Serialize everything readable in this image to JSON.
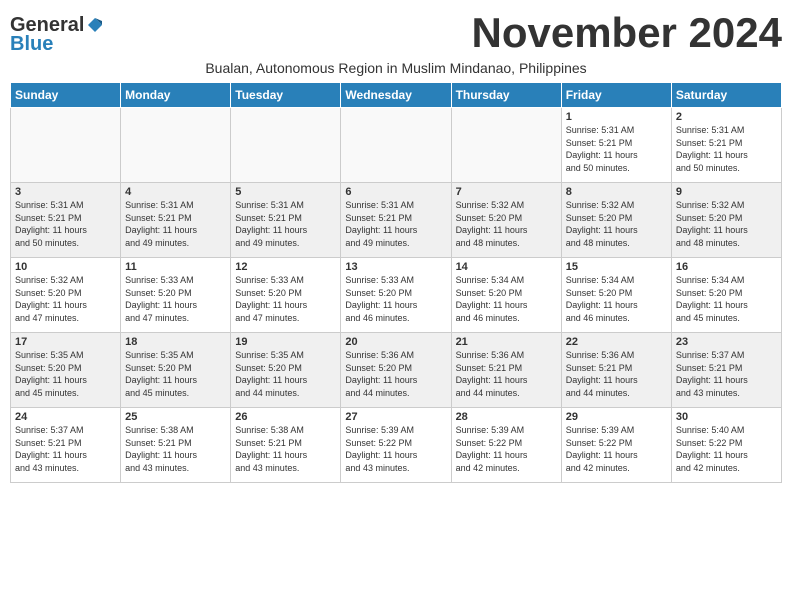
{
  "logo": {
    "general": "General",
    "blue": "Blue"
  },
  "title": "November 2024",
  "subtitle": "Bualan, Autonomous Region in Muslim Mindanao, Philippines",
  "days_of_week": [
    "Sunday",
    "Monday",
    "Tuesday",
    "Wednesday",
    "Thursday",
    "Friday",
    "Saturday"
  ],
  "weeks": [
    [
      {
        "day": "",
        "info": ""
      },
      {
        "day": "",
        "info": ""
      },
      {
        "day": "",
        "info": ""
      },
      {
        "day": "",
        "info": ""
      },
      {
        "day": "",
        "info": ""
      },
      {
        "day": "1",
        "info": "Sunrise: 5:31 AM\nSunset: 5:21 PM\nDaylight: 11 hours\nand 50 minutes."
      },
      {
        "day": "2",
        "info": "Sunrise: 5:31 AM\nSunset: 5:21 PM\nDaylight: 11 hours\nand 50 minutes."
      }
    ],
    [
      {
        "day": "3",
        "info": "Sunrise: 5:31 AM\nSunset: 5:21 PM\nDaylight: 11 hours\nand 50 minutes."
      },
      {
        "day": "4",
        "info": "Sunrise: 5:31 AM\nSunset: 5:21 PM\nDaylight: 11 hours\nand 49 minutes."
      },
      {
        "day": "5",
        "info": "Sunrise: 5:31 AM\nSunset: 5:21 PM\nDaylight: 11 hours\nand 49 minutes."
      },
      {
        "day": "6",
        "info": "Sunrise: 5:31 AM\nSunset: 5:21 PM\nDaylight: 11 hours\nand 49 minutes."
      },
      {
        "day": "7",
        "info": "Sunrise: 5:32 AM\nSunset: 5:20 PM\nDaylight: 11 hours\nand 48 minutes."
      },
      {
        "day": "8",
        "info": "Sunrise: 5:32 AM\nSunset: 5:20 PM\nDaylight: 11 hours\nand 48 minutes."
      },
      {
        "day": "9",
        "info": "Sunrise: 5:32 AM\nSunset: 5:20 PM\nDaylight: 11 hours\nand 48 minutes."
      }
    ],
    [
      {
        "day": "10",
        "info": "Sunrise: 5:32 AM\nSunset: 5:20 PM\nDaylight: 11 hours\nand 47 minutes."
      },
      {
        "day": "11",
        "info": "Sunrise: 5:33 AM\nSunset: 5:20 PM\nDaylight: 11 hours\nand 47 minutes."
      },
      {
        "day": "12",
        "info": "Sunrise: 5:33 AM\nSunset: 5:20 PM\nDaylight: 11 hours\nand 47 minutes."
      },
      {
        "day": "13",
        "info": "Sunrise: 5:33 AM\nSunset: 5:20 PM\nDaylight: 11 hours\nand 46 minutes."
      },
      {
        "day": "14",
        "info": "Sunrise: 5:34 AM\nSunset: 5:20 PM\nDaylight: 11 hours\nand 46 minutes."
      },
      {
        "day": "15",
        "info": "Sunrise: 5:34 AM\nSunset: 5:20 PM\nDaylight: 11 hours\nand 46 minutes."
      },
      {
        "day": "16",
        "info": "Sunrise: 5:34 AM\nSunset: 5:20 PM\nDaylight: 11 hours\nand 45 minutes."
      }
    ],
    [
      {
        "day": "17",
        "info": "Sunrise: 5:35 AM\nSunset: 5:20 PM\nDaylight: 11 hours\nand 45 minutes."
      },
      {
        "day": "18",
        "info": "Sunrise: 5:35 AM\nSunset: 5:20 PM\nDaylight: 11 hours\nand 45 minutes."
      },
      {
        "day": "19",
        "info": "Sunrise: 5:35 AM\nSunset: 5:20 PM\nDaylight: 11 hours\nand 44 minutes."
      },
      {
        "day": "20",
        "info": "Sunrise: 5:36 AM\nSunset: 5:20 PM\nDaylight: 11 hours\nand 44 minutes."
      },
      {
        "day": "21",
        "info": "Sunrise: 5:36 AM\nSunset: 5:21 PM\nDaylight: 11 hours\nand 44 minutes."
      },
      {
        "day": "22",
        "info": "Sunrise: 5:36 AM\nSunset: 5:21 PM\nDaylight: 11 hours\nand 44 minutes."
      },
      {
        "day": "23",
        "info": "Sunrise: 5:37 AM\nSunset: 5:21 PM\nDaylight: 11 hours\nand 43 minutes."
      }
    ],
    [
      {
        "day": "24",
        "info": "Sunrise: 5:37 AM\nSunset: 5:21 PM\nDaylight: 11 hours\nand 43 minutes."
      },
      {
        "day": "25",
        "info": "Sunrise: 5:38 AM\nSunset: 5:21 PM\nDaylight: 11 hours\nand 43 minutes."
      },
      {
        "day": "26",
        "info": "Sunrise: 5:38 AM\nSunset: 5:21 PM\nDaylight: 11 hours\nand 43 minutes."
      },
      {
        "day": "27",
        "info": "Sunrise: 5:39 AM\nSunset: 5:22 PM\nDaylight: 11 hours\nand 43 minutes."
      },
      {
        "day": "28",
        "info": "Sunrise: 5:39 AM\nSunset: 5:22 PM\nDaylight: 11 hours\nand 42 minutes."
      },
      {
        "day": "29",
        "info": "Sunrise: 5:39 AM\nSunset: 5:22 PM\nDaylight: 11 hours\nand 42 minutes."
      },
      {
        "day": "30",
        "info": "Sunrise: 5:40 AM\nSunset: 5:22 PM\nDaylight: 11 hours\nand 42 minutes."
      }
    ]
  ]
}
